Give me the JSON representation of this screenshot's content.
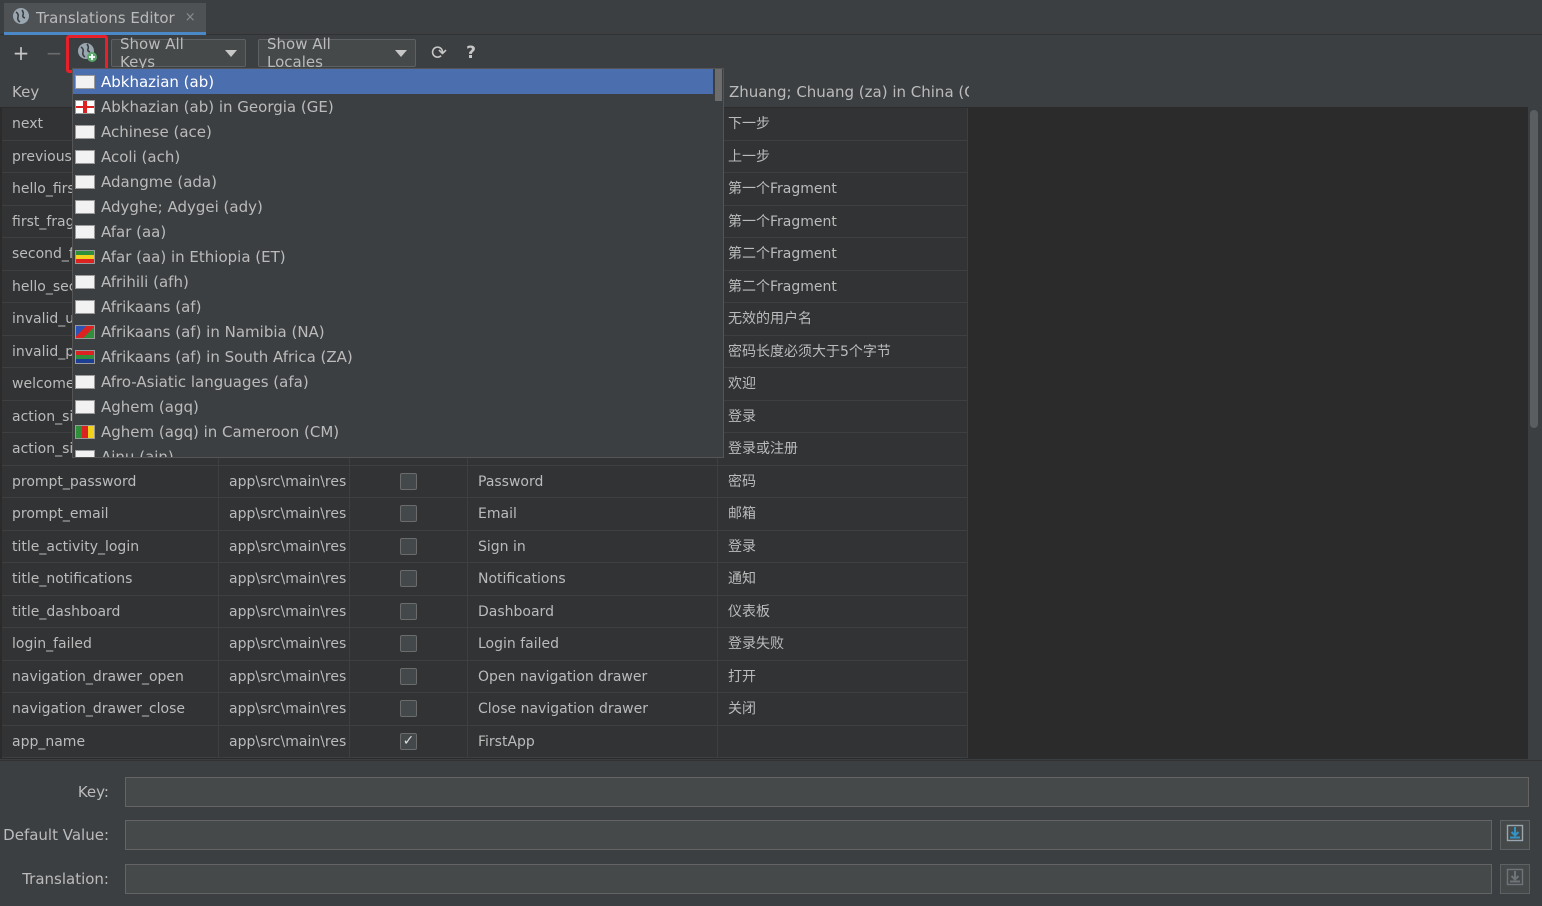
{
  "tab": {
    "title": "Translations Editor",
    "close": "×"
  },
  "toolbar": {
    "add": "+",
    "remove": "−",
    "keys_filter": "Show All Keys",
    "locales_filter": "Show All Locales",
    "refresh": "⟳",
    "help": "?"
  },
  "table": {
    "headers": [
      "Key",
      "Zhuang; Chuang (za) in China (C..."
    ],
    "rows": [
      {
        "key": "next",
        "translation": "下一步"
      },
      {
        "key": "previous",
        "translation": "上一步"
      },
      {
        "key": "hello_first",
        "translation": "第一个Fragment"
      },
      {
        "key": "first_fragr",
        "translation": "第一个Fragment"
      },
      {
        "key": "second_f",
        "translation": "第二个Fragment"
      },
      {
        "key": "hello_sec",
        "translation": "第二个Fragment"
      },
      {
        "key": "invalid_us",
        "translation": "无效的用户名"
      },
      {
        "key": "invalid_pa",
        "translation": "密码长度必须大于5个字节"
      },
      {
        "key": "welcome",
        "translation": "欢迎"
      },
      {
        "key": "action_sig",
        "translation": "登录"
      },
      {
        "key": "action_sig",
        "translation": "登录或注册"
      },
      {
        "key": "prompt_password",
        "resource": "app\\src\\main\\res",
        "untranslatable": false,
        "default": "Password",
        "translation": "密码"
      },
      {
        "key": "prompt_email",
        "resource": "app\\src\\main\\res",
        "untranslatable": false,
        "default": "Email",
        "translation": "邮箱"
      },
      {
        "key": "title_activity_login",
        "resource": "app\\src\\main\\res",
        "untranslatable": false,
        "default": "Sign in",
        "translation": "登录"
      },
      {
        "key": "title_notifications",
        "resource": "app\\src\\main\\res",
        "untranslatable": false,
        "default": "Notifications",
        "translation": "通知"
      },
      {
        "key": "title_dashboard",
        "resource": "app\\src\\main\\res",
        "untranslatable": false,
        "default": "Dashboard",
        "translation": "仪表板"
      },
      {
        "key": "login_failed",
        "resource": "app\\src\\main\\res",
        "untranslatable": false,
        "default": "Login failed",
        "translation": "登录失败"
      },
      {
        "key": "navigation_drawer_open",
        "resource": "app\\src\\main\\res",
        "untranslatable": false,
        "default": "Open navigation drawer",
        "translation": "打开"
      },
      {
        "key": "navigation_drawer_close",
        "resource": "app\\src\\main\\res",
        "untranslatable": false,
        "default": "Close navigation drawer",
        "translation": "关闭"
      },
      {
        "key": "app_name",
        "resource": "app\\src\\main\\res",
        "untranslatable": true,
        "default": "FirstApp",
        "translation": ""
      }
    ]
  },
  "locale_popup": {
    "selected": "Abkhazian (ab)",
    "items": [
      "Abkhazian (ab)",
      "Abkhazian (ab) in Georgia (GE)",
      "Achinese (ace)",
      "Acoli (ach)",
      "Adangme (ada)",
      "Adyghe; Adygei (ady)",
      "Afar (aa)",
      "Afar (aa) in Ethiopia (ET)",
      "Afrihili (afh)",
      "Afrikaans (af)",
      "Afrikaans (af) in Namibia (NA)",
      "Afrikaans (af) in South Africa (ZA)",
      "Afro-Asiatic languages (afa)",
      "Aghem (agq)",
      "Aghem (agq) in Cameroon (CM)",
      "Ainu (ain)"
    ]
  },
  "form": {
    "key_label": "Key:",
    "default_label": "Default Value:",
    "translation_label": "Translation:",
    "key_value": "",
    "default_value": "",
    "translation_value": ""
  },
  "colors": {
    "accent": "#4b6eaf",
    "highlight_box": "#e8202a",
    "background": "#3c3f41"
  }
}
